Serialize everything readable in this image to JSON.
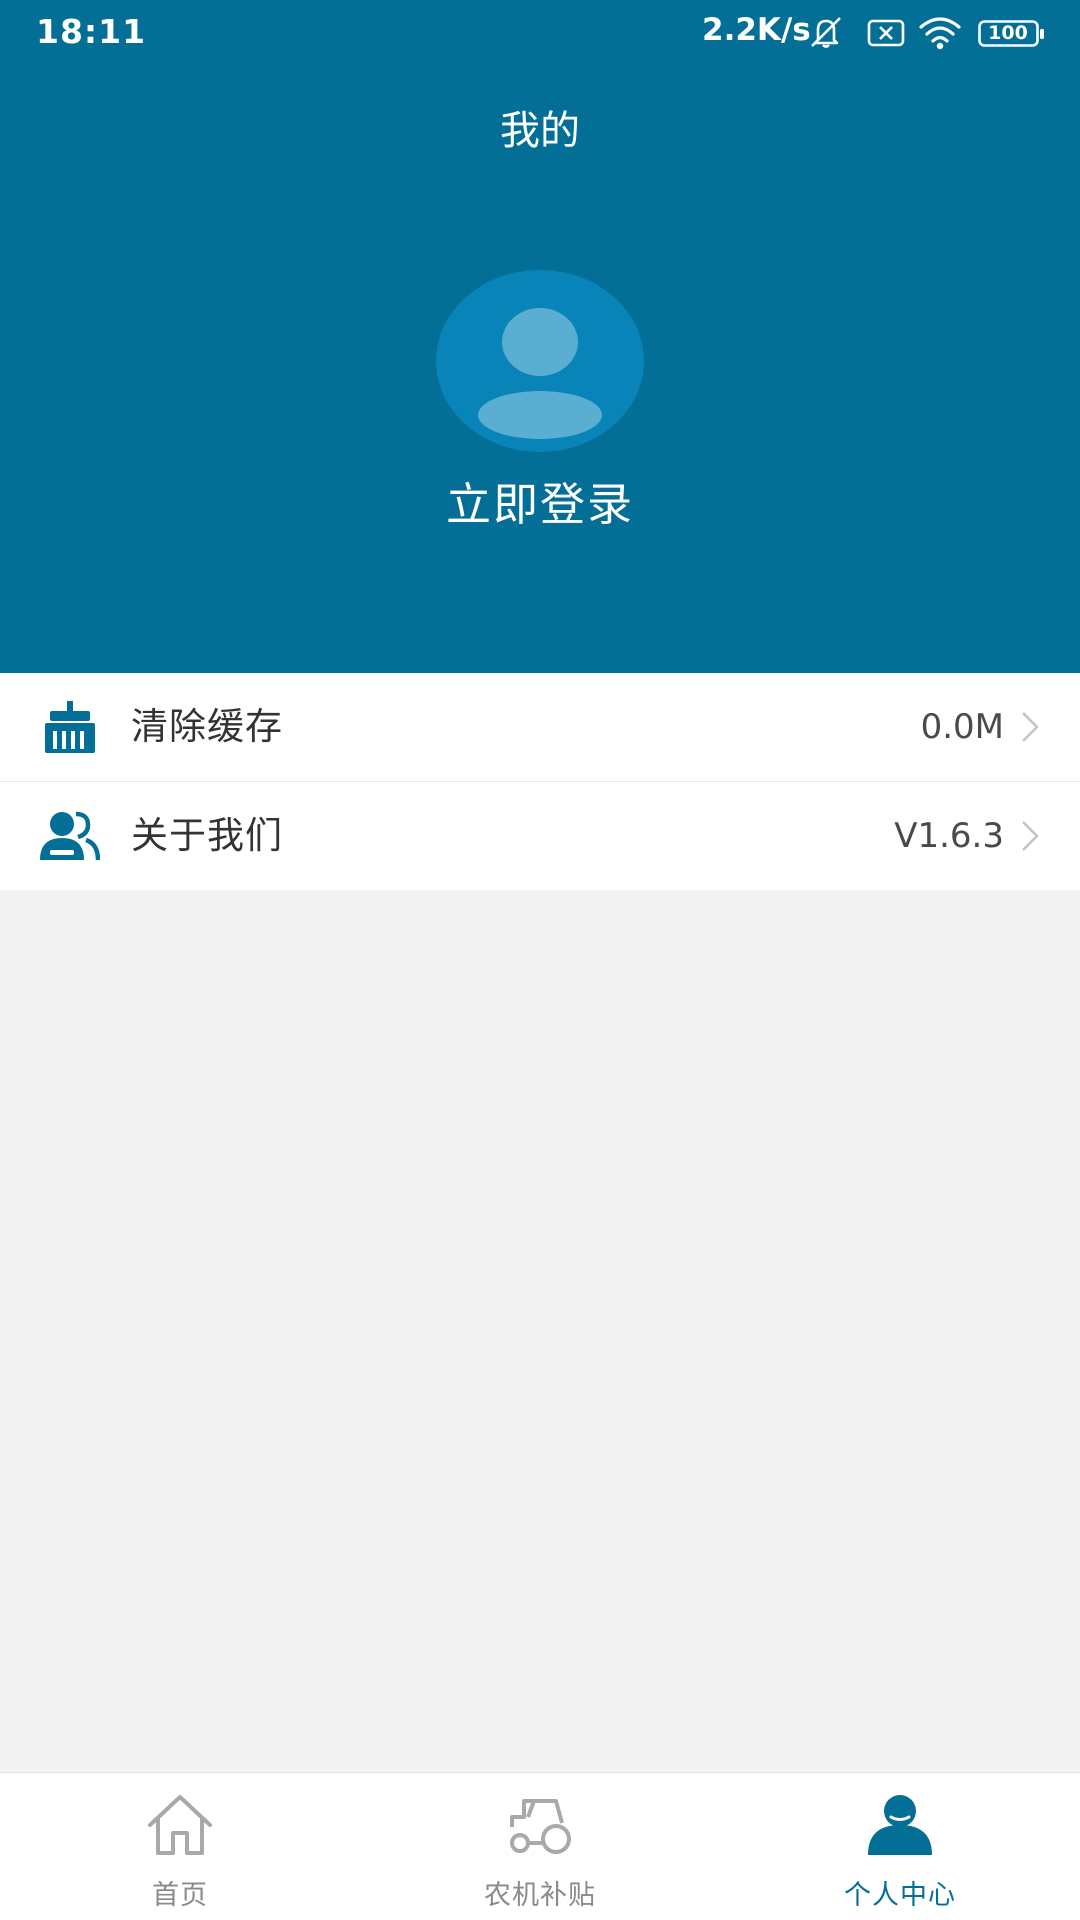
{
  "status_bar": {
    "time": "18:11",
    "network_speed": "2.2K/s",
    "battery_level": "100",
    "icons": [
      "mute-icon",
      "sim-off-icon",
      "wifi-icon",
      "battery-icon"
    ]
  },
  "header": {
    "title": "我的",
    "login_label": "立即登录",
    "background_color": "#046f96"
  },
  "menu": {
    "items": [
      {
        "label": "清除缓存",
        "value": "0.0M",
        "icon": "broom-icon"
      },
      {
        "label": "关于我们",
        "value": "V1.6.3",
        "icon": "users-icon"
      }
    ]
  },
  "bottom_nav": {
    "items": [
      {
        "label": "首页",
        "icon": "home-icon",
        "active": false
      },
      {
        "label": "农机补贴",
        "icon": "tractor-icon",
        "active": false
      },
      {
        "label": "个人中心",
        "icon": "person-icon",
        "active": true
      }
    ],
    "active_color": "#046f96",
    "inactive_color": "#8a8a8a"
  }
}
